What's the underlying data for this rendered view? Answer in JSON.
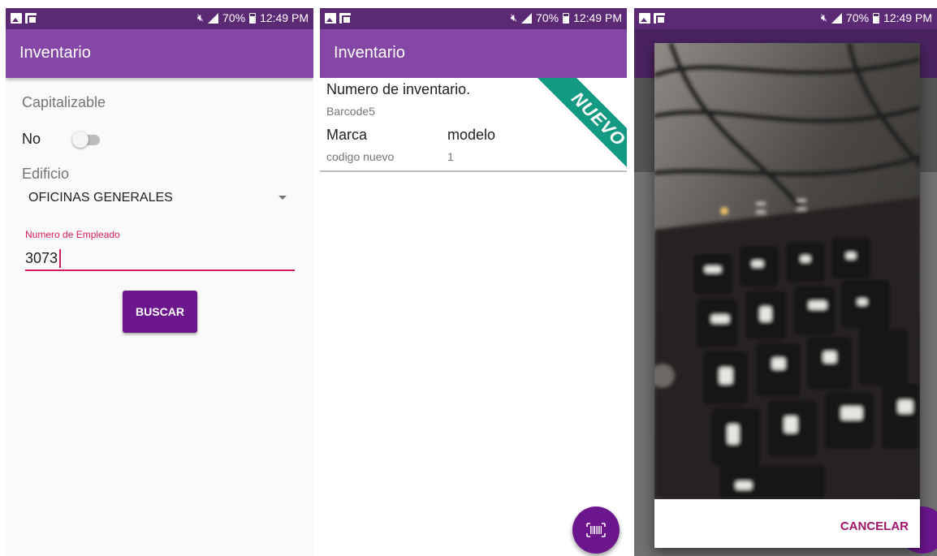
{
  "status_bar": {
    "battery": "70%",
    "time": "12:49 PM"
  },
  "app": {
    "title": "Inventario"
  },
  "screen1": {
    "capitalizable_label": "Capitalizable",
    "switch_value_label": "No",
    "edificio_label": "Edificio",
    "edificio_value": "OFICINAS GENERALES",
    "empleado_label": "Numero de Empleado",
    "empleado_value": "3073",
    "search_button": "BUSCAR"
  },
  "screen2": {
    "card": {
      "inventory_label": "Numero de inventario.",
      "inventory_value": "Barcode5",
      "marca_label": "Marca",
      "marca_value": "codigo nuevo",
      "modelo_label": "modelo",
      "modelo_value": "1",
      "badge": "NUEVO"
    },
    "fab_icon": "barcode-scan-icon"
  },
  "screen3": {
    "cancel_button": "CANCELAR"
  },
  "colors": {
    "status_bar": "#5c2a75",
    "app_bar": "#8447a5",
    "primary_button": "#6c168e",
    "accent": "#d81b60",
    "badge": "#139a82"
  }
}
